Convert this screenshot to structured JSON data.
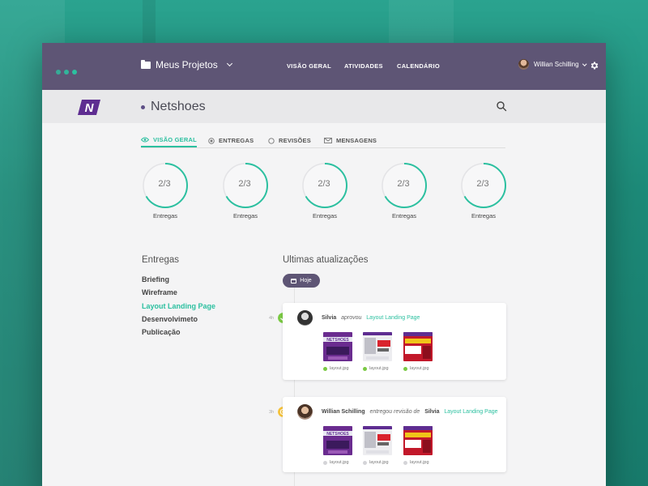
{
  "colors": {
    "accent": "#2cc0a0",
    "header": "#5e5575",
    "approved": "#7ac943",
    "pending": "#f5c23a"
  },
  "window_dots": [
    "#2cc0a0",
    "#2cc0a0",
    "#2cc0a0"
  ],
  "header": {
    "projects_label": "Meus Projetos",
    "nav": [
      "VISÃO GERAL",
      "ATIVIDADES",
      "CALENDÁRIO"
    ],
    "user_name": "Willian Schilling"
  },
  "project": {
    "title": "Netshoes",
    "logo_text": "N"
  },
  "tabs": [
    {
      "label": "VISÃO GERAL",
      "icon": "eye-icon",
      "active": true
    },
    {
      "label": "ENTREGAS",
      "icon": "target-icon",
      "active": false
    },
    {
      "label": "REVISÕES",
      "icon": "circle-icon",
      "active": false
    },
    {
      "label": "MENSAGENS",
      "icon": "envelope-icon",
      "active": false
    }
  ],
  "progress": [
    {
      "value": "2/3",
      "done": 2,
      "total": 3,
      "label": "Entregas"
    },
    {
      "value": "2/3",
      "done": 2,
      "total": 3,
      "label": "Entregas"
    },
    {
      "value": "2/3",
      "done": 2,
      "total": 3,
      "label": "Entregas"
    },
    {
      "value": "2/3",
      "done": 2,
      "total": 3,
      "label": "Entregas"
    },
    {
      "value": "2/3",
      "done": 2,
      "total": 3,
      "label": "Entregas"
    }
  ],
  "deliverables": {
    "title": "Entregas",
    "items": [
      {
        "label": "Briefing",
        "active": false
      },
      {
        "label": "Wireframe",
        "active": false
      },
      {
        "label": "Layout Landing Page",
        "active": true
      },
      {
        "label": "Desenvolvimeto",
        "active": false
      },
      {
        "label": "Publicação",
        "active": false
      }
    ]
  },
  "updates": {
    "title": "Ultimas atualizações",
    "today_label": "Hoje",
    "items": [
      {
        "time": "4h",
        "status": "approved",
        "user": "Silvia",
        "action": "aprovou",
        "target_user": "",
        "link": "Layout Landing Page",
        "files": [
          {
            "name": "layout.jpg",
            "status": "approved"
          },
          {
            "name": "layout.jpg",
            "status": "approved"
          },
          {
            "name": "layout.jpg",
            "status": "approved"
          }
        ]
      },
      {
        "time": "3h",
        "status": "pending",
        "user": "Willian Schilling",
        "action": "entregou revisão de",
        "target_user": "Silvia",
        "link": "Layout Landing Page",
        "files": [
          {
            "name": "layout.jpg",
            "status": "none"
          },
          {
            "name": "layout.jpg",
            "status": "none"
          },
          {
            "name": "layout.jpg",
            "status": "none"
          }
        ]
      }
    ]
  }
}
